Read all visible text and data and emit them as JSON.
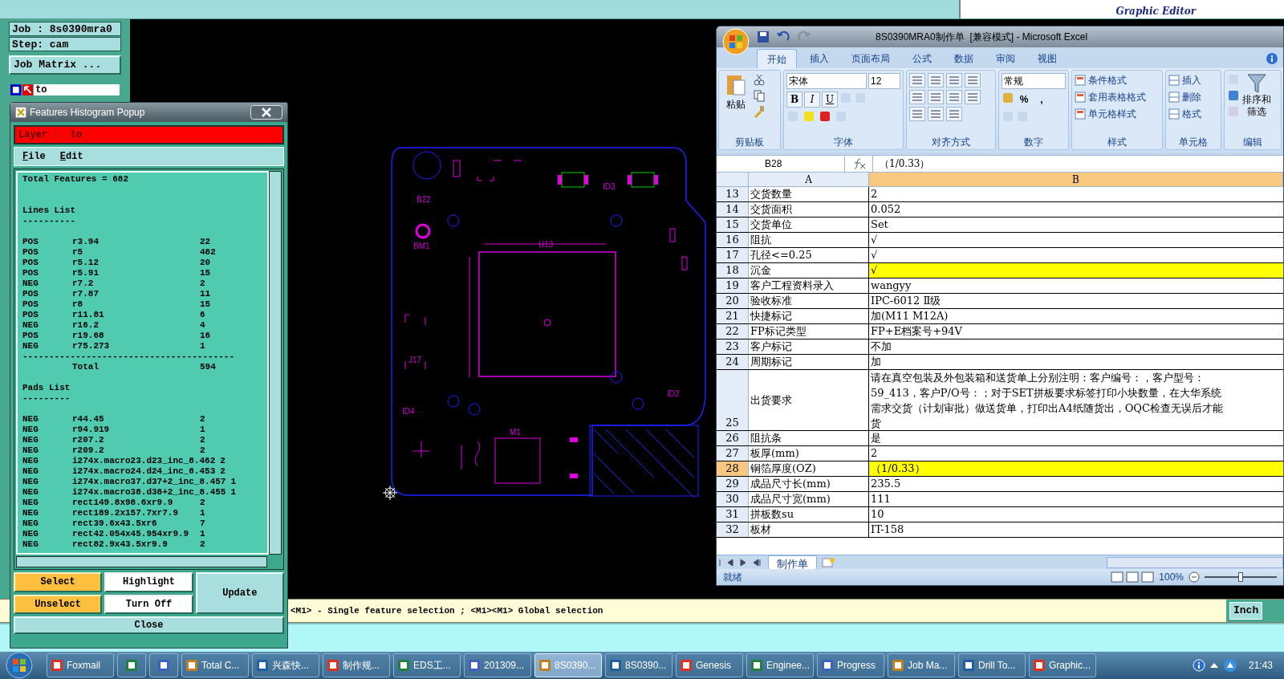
{
  "top_bar": {
    "logo_subtitle": "Graphic Editor"
  },
  "job_panel": {
    "job": "Job : 8s0390mra0",
    "step": "Step: cam",
    "job_matrix_button": "Job Matrix ...",
    "layer": "to"
  },
  "pcb": {
    "labels": [
      "B22",
      "BM1",
      "U13",
      "ID3",
      "ID4",
      "ID2",
      "J17",
      "M1"
    ]
  },
  "histogram": {
    "title": "Features Histogram Popup",
    "layer": "Layer :  to",
    "menu": [
      {
        "label": "File"
      },
      {
        "label": "Edit"
      }
    ],
    "total_features": "Total Features = 682",
    "lines_heading": "Lines List",
    "lines_rule": "----------",
    "lines": [
      {
        "polarity": "POS",
        "symbol": "r3.94",
        "count": "22"
      },
      {
        "polarity": "POS",
        "symbol": "r5",
        "count": "482"
      },
      {
        "polarity": "POS",
        "symbol": "r5.12",
        "count": "20"
      },
      {
        "polarity": "POS",
        "symbol": "r5.91",
        "count": "15"
      },
      {
        "polarity": "NEG",
        "symbol": "r7.2",
        "count": "2"
      },
      {
        "polarity": "POS",
        "symbol": "r7.87",
        "count": "11"
      },
      {
        "polarity": "POS",
        "symbol": "r8",
        "count": "15"
      },
      {
        "polarity": "POS",
        "symbol": "r11.81",
        "count": "6"
      },
      {
        "polarity": "NEG",
        "symbol": "r16.2",
        "count": "4"
      },
      {
        "polarity": "POS",
        "symbol": "r19.68",
        "count": "16"
      },
      {
        "polarity": "NEG",
        "symbol": "r75.273",
        "count": "1"
      }
    ],
    "total_rule": "----------------------------------------",
    "total_label": "Total",
    "total_count": "594",
    "pads_heading": "Pads List",
    "pads_rule": "---------",
    "pads": [
      {
        "polarity": "NEG",
        "symbol": "r44.45",
        "count": "2"
      },
      {
        "polarity": "NEG",
        "symbol": "r94.919",
        "count": "1"
      },
      {
        "polarity": "NEG",
        "symbol": "r207.2",
        "count": "2"
      },
      {
        "polarity": "NEG",
        "symbol": "r209.2",
        "count": "2"
      },
      {
        "polarity": "NEG",
        "symbol": "i274x.macro23.d23_inc_8.462",
        "count": "2"
      },
      {
        "polarity": "NEG",
        "symbol": "i274x.macro24.d24_inc_8.453",
        "count": "2"
      },
      {
        "polarity": "NEG",
        "symbol": "i274x.macro37.d37+2_inc_8.457",
        "count": "1"
      },
      {
        "polarity": "NEG",
        "symbol": "i274x.macro38.d38+2_inc_8.455",
        "count": "1"
      },
      {
        "polarity": "NEG",
        "symbol": "rect149.8x98.6xr9.9",
        "count": "2"
      },
      {
        "polarity": "NEG",
        "symbol": "rect189.2x157.7xr7.9",
        "count": "1"
      },
      {
        "polarity": "NEG",
        "symbol": "rect39.6x43.5xr6",
        "count": "7"
      },
      {
        "polarity": "NEG",
        "symbol": "rect42.054x45.954xr9.9",
        "count": "1"
      },
      {
        "polarity": "NEG",
        "symbol": "rect82.9x43.5xr9.9",
        "count": "2"
      }
    ],
    "buttons": [
      {
        "label": "Select",
        "kind": "action"
      },
      {
        "label": "Highlight",
        "kind": "toggle"
      },
      {
        "label": "Update",
        "kind": "plain"
      },
      {
        "label": "Unselect",
        "kind": "action"
      },
      {
        "label": "Turn Off",
        "kind": "toggle"
      }
    ],
    "close_button": "Close"
  },
  "excel": {
    "title": "8S0390MRA0制作单  [兼容模式] - Microsoft Excel",
    "tabs": [
      {
        "label": "开始",
        "selected": true
      },
      {
        "label": "插入",
        "selected": false
      },
      {
        "label": "页面布局",
        "selected": false
      },
      {
        "label": "公式",
        "selected": false
      },
      {
        "label": "数据",
        "selected": false
      },
      {
        "label": "审阅",
        "selected": false
      },
      {
        "label": "视图",
        "selected": false
      }
    ],
    "ribbon": {
      "paste": "粘贴",
      "font": "宋体",
      "font_size": "12",
      "format_buttons": [
        "B",
        "I",
        "U"
      ],
      "number_format": "常规",
      "number_buttons": [
        "%",
        ","
      ],
      "styles": [
        "条件格式",
        "套用表格格式",
        "单元格样式"
      ],
      "cells": [
        "插入",
        "删除",
        "格式"
      ],
      "sort": [
        "排序和",
        "筛选"
      ],
      "groups": [
        "剪贴板",
        "字体",
        "对齐方式",
        "数字",
        "样式",
        "单元格",
        "编辑"
      ]
    },
    "name_box": "B28",
    "formula": "（1/0.33）",
    "columns": [
      {
        "label": "A",
        "selected": false
      },
      {
        "label": "B",
        "selected": true
      }
    ],
    "rows": [
      {
        "number": "13",
        "label": "交货数量",
        "value": "2",
        "highlighted": false,
        "selected": false
      },
      {
        "number": "14",
        "label": "交货面积",
        "value": "0.052",
        "highlighted": false,
        "selected": false
      },
      {
        "number": "15",
        "label": "交货单位",
        "value": "Set",
        "highlighted": false,
        "selected": false
      },
      {
        "number": "16",
        "label": "阻抗",
        "value": "√",
        "highlighted": false,
        "selected": false
      },
      {
        "number": "17",
        "label": "孔径<=0.25",
        "value": "√",
        "highlighted": false,
        "selected": false
      },
      {
        "number": "18",
        "label": "沉金",
        "value": "√",
        "highlighted": true,
        "selected": false
      },
      {
        "number": "19",
        "label": "客户工程资料录入",
        "value": "wangyy",
        "highlighted": false,
        "selected": false
      },
      {
        "number": "20",
        "label": "验收标准",
        "value": "IPC-6012 Ⅱ级",
        "highlighted": false,
        "selected": false
      },
      {
        "number": "21",
        "label": "快捷标记",
        "value": "加(M11 M12A)",
        "highlighted": false,
        "selected": false
      },
      {
        "number": "22",
        "label": "FP标记类型",
        "value": "FP+E档案号+94V",
        "highlighted": false,
        "selected": false
      },
      {
        "number": "23",
        "label": "客户标记",
        "value": "不加",
        "highlighted": false,
        "selected": false
      },
      {
        "number": "24",
        "label": "周期标记",
        "value": "加",
        "highlighted": false,
        "selected": false
      },
      {
        "number": "25",
        "label": "出货要求",
        "value_lines": [
          "请在真空包装及外包装箱和送货单上分别注明：客户编号：，客户型号：",
          "59_413，客户P/O号：；对于SET拼板要求标签打印小块数量，在大华系统",
          "需求交货（计划审批）做送货单，打印出A4纸随货出，OQC检查无误后才能",
          "货"
        ],
        "highlighted": false,
        "selected": false
      },
      {
        "number": "26",
        "label": "阻抗条",
        "value": "是",
        "highlighted": false,
        "selected": false
      },
      {
        "number": "27",
        "label": "板厚(mm)",
        "value": "2",
        "highlighted": false,
        "selected": false
      },
      {
        "number": "28",
        "label": "铜箔厚度(OZ)",
        "value": "（1/0.33）",
        "highlighted": true,
        "selected": true
      },
      {
        "number": "29",
        "label": "成品尺寸长(mm)",
        "value": "235.5",
        "highlighted": false,
        "selected": false
      },
      {
        "number": "30",
        "label": "成品尺寸宽(mm)",
        "value": "111",
        "highlighted": false,
        "selected": false
      },
      {
        "number": "31",
        "label": "拼板数su",
        "value": "10",
        "highlighted": false,
        "selected": false
      },
      {
        "number": "32",
        "label": "板材",
        "value": "IT-158",
        "highlighted": false,
        "selected": false
      }
    ],
    "sheet_tab": "制作单",
    "status": "就绪",
    "zoom": "100%",
    "zoom_slider": {
      "level": 0.5
    }
  },
  "status_bar": {
    "hint": "<M1> - Single feature selection ; <M1><M1> Global selection",
    "unit": "Inch"
  },
  "taskbar": {
    "items": [
      {
        "kind": "button",
        "label": "Foxmail",
        "selected": false
      },
      {
        "kind": "icon",
        "selected": false
      },
      {
        "kind": "icon",
        "selected": false
      },
      {
        "kind": "button",
        "label": "Total C...",
        "selected": false
      },
      {
        "kind": "button",
        "label": "兴森快...",
        "selected": false
      },
      {
        "kind": "button",
        "label": "制作规...",
        "selected": false
      },
      {
        "kind": "button",
        "label": "EDS工...",
        "selected": false
      },
      {
        "kind": "button",
        "label": "201309...",
        "selected": false
      },
      {
        "kind": "button",
        "label": "8S0390...",
        "selected": true
      },
      {
        "kind": "button",
        "label": "8S0390...",
        "selected": false
      },
      {
        "kind": "button",
        "label": "Genesis",
        "selected": false
      },
      {
        "kind": "button",
        "label": "Enginee...",
        "selected": false
      },
      {
        "kind": "button",
        "label": "Progress",
        "selected": false
      },
      {
        "kind": "button",
        "label": "Job Ma...",
        "selected": false
      },
      {
        "kind": "button",
        "label": "Drill To...",
        "selected": false
      },
      {
        "kind": "button",
        "label": "Graphic...",
        "selected": false
      }
    ],
    "clock": "21:43"
  }
}
